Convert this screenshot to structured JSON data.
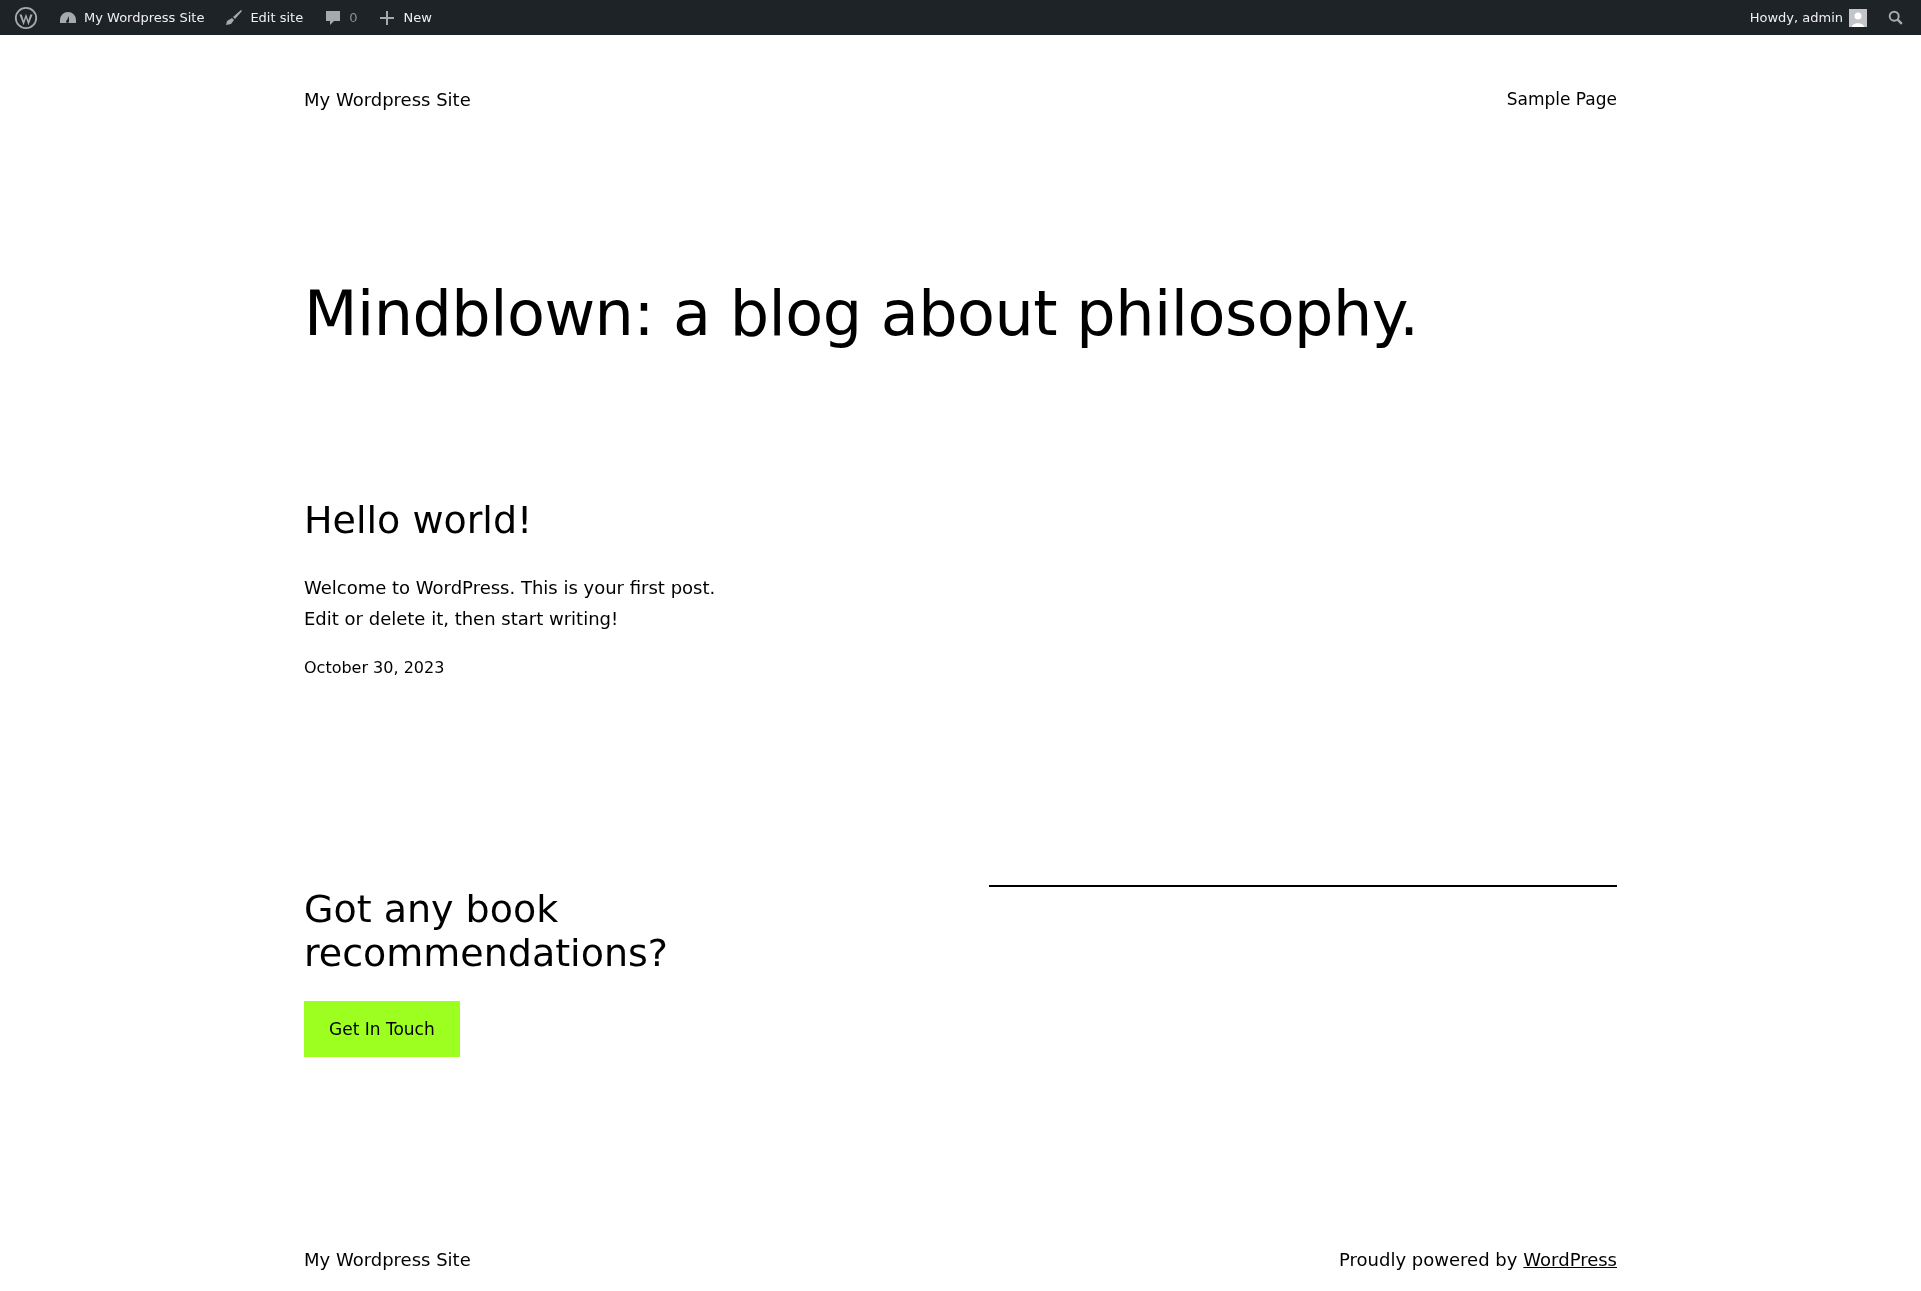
{
  "admin_bar": {
    "site": "My Wordpress Site",
    "edit": "Edit site",
    "comments": "0",
    "new": "New",
    "greeting": "Howdy, admin"
  },
  "header": {
    "site_title": "My Wordpress Site",
    "nav": [
      "Sample Page"
    ]
  },
  "hero": {
    "title": "Mindblown: a blog about philosophy."
  },
  "posts": [
    {
      "title": "Hello world!",
      "lines": [
        "Welcome to WordPress. This is your first post.",
        "Edit or delete it, then start writing!"
      ],
      "date": "October 30, 2023"
    }
  ],
  "cta": {
    "heading": "Got any book recommendations?",
    "button": "Get In Touch"
  },
  "footer": {
    "site_title": "My Wordpress Site",
    "credit": "Proudly powered by",
    "link": "WordPress"
  }
}
